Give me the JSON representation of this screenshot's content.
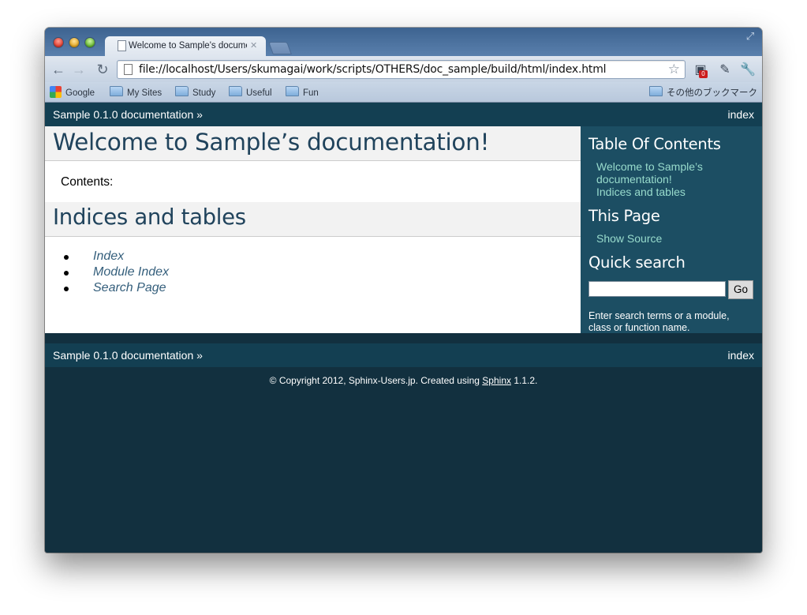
{
  "browser": {
    "tab_title": "Welcome to Sample's documentation",
    "url": "file://localhost/Users/skumagai/work/scripts/OTHERS/doc_sample/build/html/index.html",
    "extension_badge": "0",
    "bookmarks": [
      "Google",
      "My Sites",
      "Study",
      "Useful",
      "Fun"
    ],
    "other_bookmarks": "その他のブックマーク"
  },
  "relbar": {
    "left_text": "Sample 0.1.0 documentation »",
    "right_text": "index"
  },
  "main": {
    "title": "Welcome to Sample’s documentation!",
    "contents_label": "Contents:",
    "section_title": "Indices and tables",
    "links": [
      "Index",
      "Module Index",
      "Search Page"
    ]
  },
  "sidebar": {
    "toc_heading": "Table Of Contents",
    "toc_links": [
      "Welcome to Sample’s documentation!",
      "Indices and tables"
    ],
    "this_page_heading": "This Page",
    "show_source": "Show Source",
    "quick_search_heading": "Quick search",
    "search_button": "Go",
    "search_hint": "Enter search terms or a module, class or function name."
  },
  "footer": {
    "prefix": "© Copyright 2012, Sphinx-Users.jp. Created using ",
    "link": "Sphinx",
    "suffix": " 1.1.2."
  }
}
